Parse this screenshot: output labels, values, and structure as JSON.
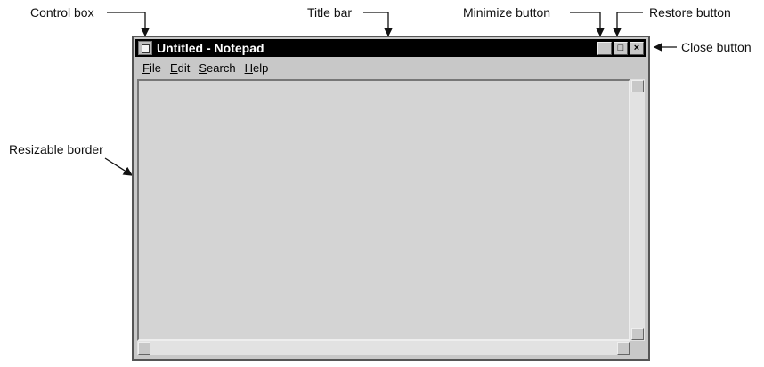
{
  "callouts": {
    "control_box": "Control box",
    "title_bar": "Title bar",
    "minimize_button": "Minimize button",
    "restore_button": "Restore button",
    "close_button": "Close button",
    "resizable_border": "Resizable border"
  },
  "window": {
    "title": "Untitled - Notepad",
    "menu": [
      {
        "key": "F",
        "rest": "ile"
      },
      {
        "key": "E",
        "rest": "dit"
      },
      {
        "key": "S",
        "rest": "earch"
      },
      {
        "key": "H",
        "rest": "elp"
      }
    ],
    "buttons": {
      "minimize": "_",
      "restore": "□",
      "close": "×"
    }
  }
}
